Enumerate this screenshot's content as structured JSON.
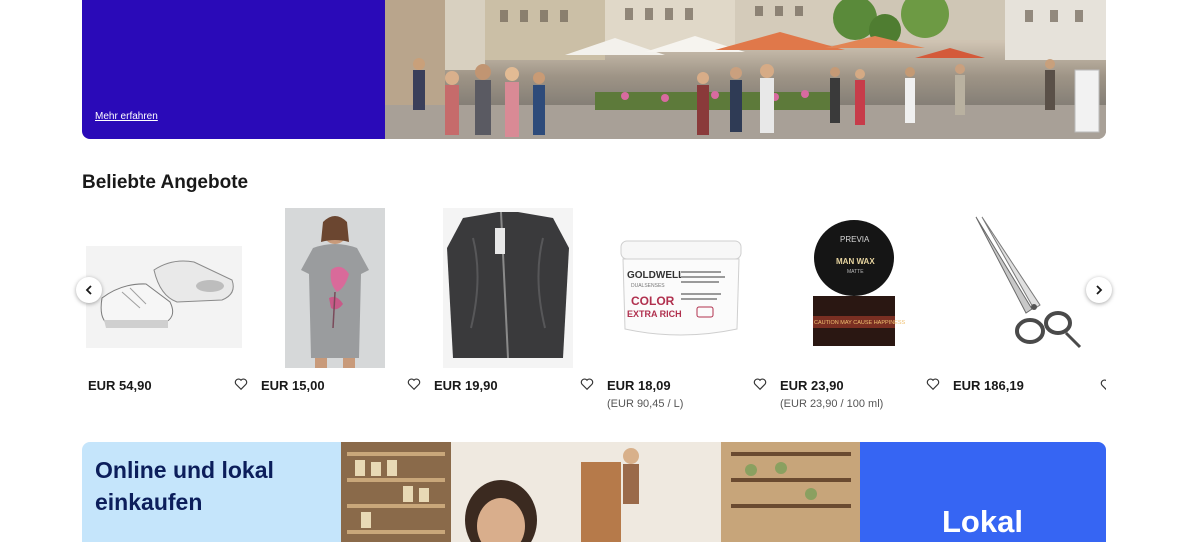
{
  "banner": {
    "link_label": "Mehr erfahren",
    "photo_alt": "Marktplatz"
  },
  "section": {
    "title": "Beliebte Angebote"
  },
  "carousel": {
    "prev_icon": "chevron-left-icon",
    "next_icon": "chevron-right-icon",
    "items": [
      {
        "name": "sneaker",
        "price": "EUR 54,90",
        "unit": ""
      },
      {
        "name": "dress",
        "price": "EUR 15,00",
        "unit": ""
      },
      {
        "name": "jacket",
        "price": "EUR 19,90",
        "unit": ""
      },
      {
        "name": "hair-mask",
        "price": "EUR 18,09",
        "unit": "(EUR 90,45 / L)"
      },
      {
        "name": "man-wax",
        "price": "EUR 23,90",
        "unit": "(EUR 23,90 / 100 ml)"
      },
      {
        "name": "scissors",
        "price": "EUR 186,19",
        "unit": ""
      }
    ],
    "product_text": {
      "goldwell_brand": "GOLDWELL.",
      "goldwell_sub": "DUALSENSES",
      "goldwell_line1": "COLOR",
      "goldwell_line2": "EXTRA RICH",
      "previa_brand": "PREVIA",
      "previa_name": "MAN WAX",
      "previa_sub": "MATTE",
      "previa_band": "CAUTION MAY CAUSE HAPPINESS"
    }
  },
  "bottom_banner": {
    "title": "Online und lokal einkaufen",
    "right_label": "Lokal"
  },
  "colors": {
    "banner_blue": "#2a0ab8",
    "light_blue": "#c5e5fb",
    "accent_blue": "#3665f3",
    "dark_navy": "#0c1e5b"
  }
}
